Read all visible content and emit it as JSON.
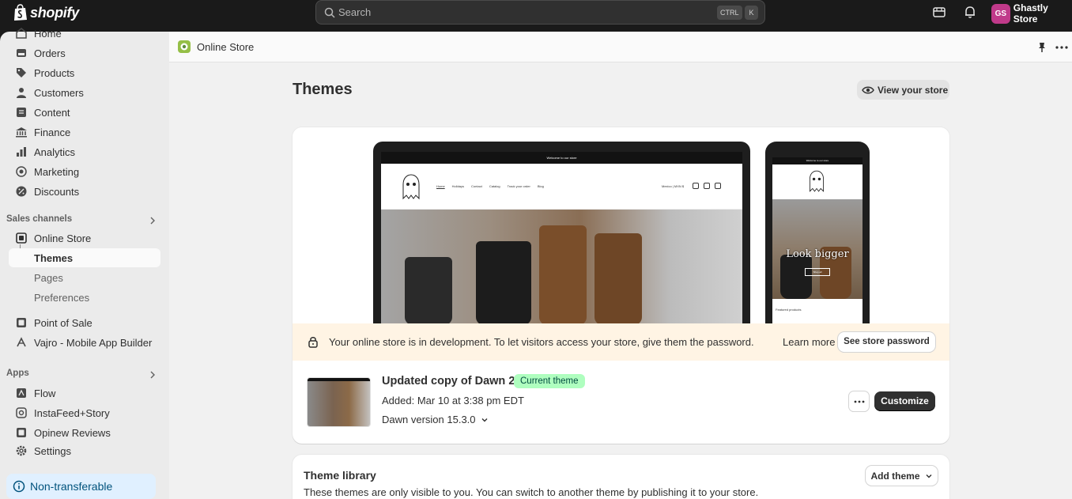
{
  "topbar": {
    "logo_text": "shopify",
    "search_placeholder": "Search",
    "kbd_ctrl": "CTRL",
    "kbd_k": "K",
    "avatar_initials": "GS",
    "store_name": "Ghastly Store"
  },
  "sidebar": {
    "items": [
      {
        "label": "Home",
        "icon": "home-icon"
      },
      {
        "label": "Orders",
        "icon": "orders-icon"
      },
      {
        "label": "Products",
        "icon": "tag-icon"
      },
      {
        "label": "Customers",
        "icon": "person-icon"
      },
      {
        "label": "Content",
        "icon": "content-icon"
      },
      {
        "label": "Finance",
        "icon": "bank-icon"
      },
      {
        "label": "Analytics",
        "icon": "chart-icon"
      },
      {
        "label": "Marketing",
        "icon": "target-icon"
      },
      {
        "label": "Discounts",
        "icon": "discount-icon"
      }
    ],
    "sales_channels_label": "Sales channels",
    "online_store": "Online Store",
    "online_store_sub": [
      "Themes",
      "Pages",
      "Preferences"
    ],
    "point_of_sale": "Point of Sale",
    "vajro": "Vajro - Mobile App Builder",
    "apps_label": "Apps",
    "apps": [
      "Flow",
      "InstaFeed+Story",
      "Opinew Reviews"
    ],
    "settings": "Settings",
    "non_transferable": "Non-transferable"
  },
  "main": {
    "header_title": "Online Store",
    "page_title": "Themes",
    "view_store": "View your store",
    "preview": {
      "desktop_announcement": "Welcome to our store",
      "desktop_menu": [
        "Home",
        "Holidays",
        "Contact",
        "Catalog",
        "Track your order",
        "Blog"
      ],
      "desktop_currency": "Mexico | MXN $",
      "mobile_announcement": "Welcome to our store",
      "mobile_headline": "Look bigger",
      "mobile_shop": "Shop all",
      "mobile_featured": "Featured products"
    },
    "dev_banner": {
      "message": "Your online store is in development. To let visitors access your store, give them the password.",
      "learn_more": "Learn more",
      "button": "See store password"
    },
    "current_theme": {
      "name": "Updated copy of Dawn 2.0",
      "badge": "Current theme",
      "added": "Added: Mar 10 at 3:38 pm EDT",
      "version": "Dawn version 15.3.0",
      "customize": "Customize"
    },
    "library": {
      "title": "Theme library",
      "description": "These themes are only visible to you. You can switch to another theme by publishing it to your store.",
      "add_theme": "Add theme"
    }
  },
  "colors": {
    "topbar": "#1a1a1a",
    "sidebar": "#ebebeb",
    "main_bg": "#f1f1f1",
    "banner_bg": "#fff4e4",
    "badge_bg": "#affebf",
    "primary_button": "#303030"
  }
}
